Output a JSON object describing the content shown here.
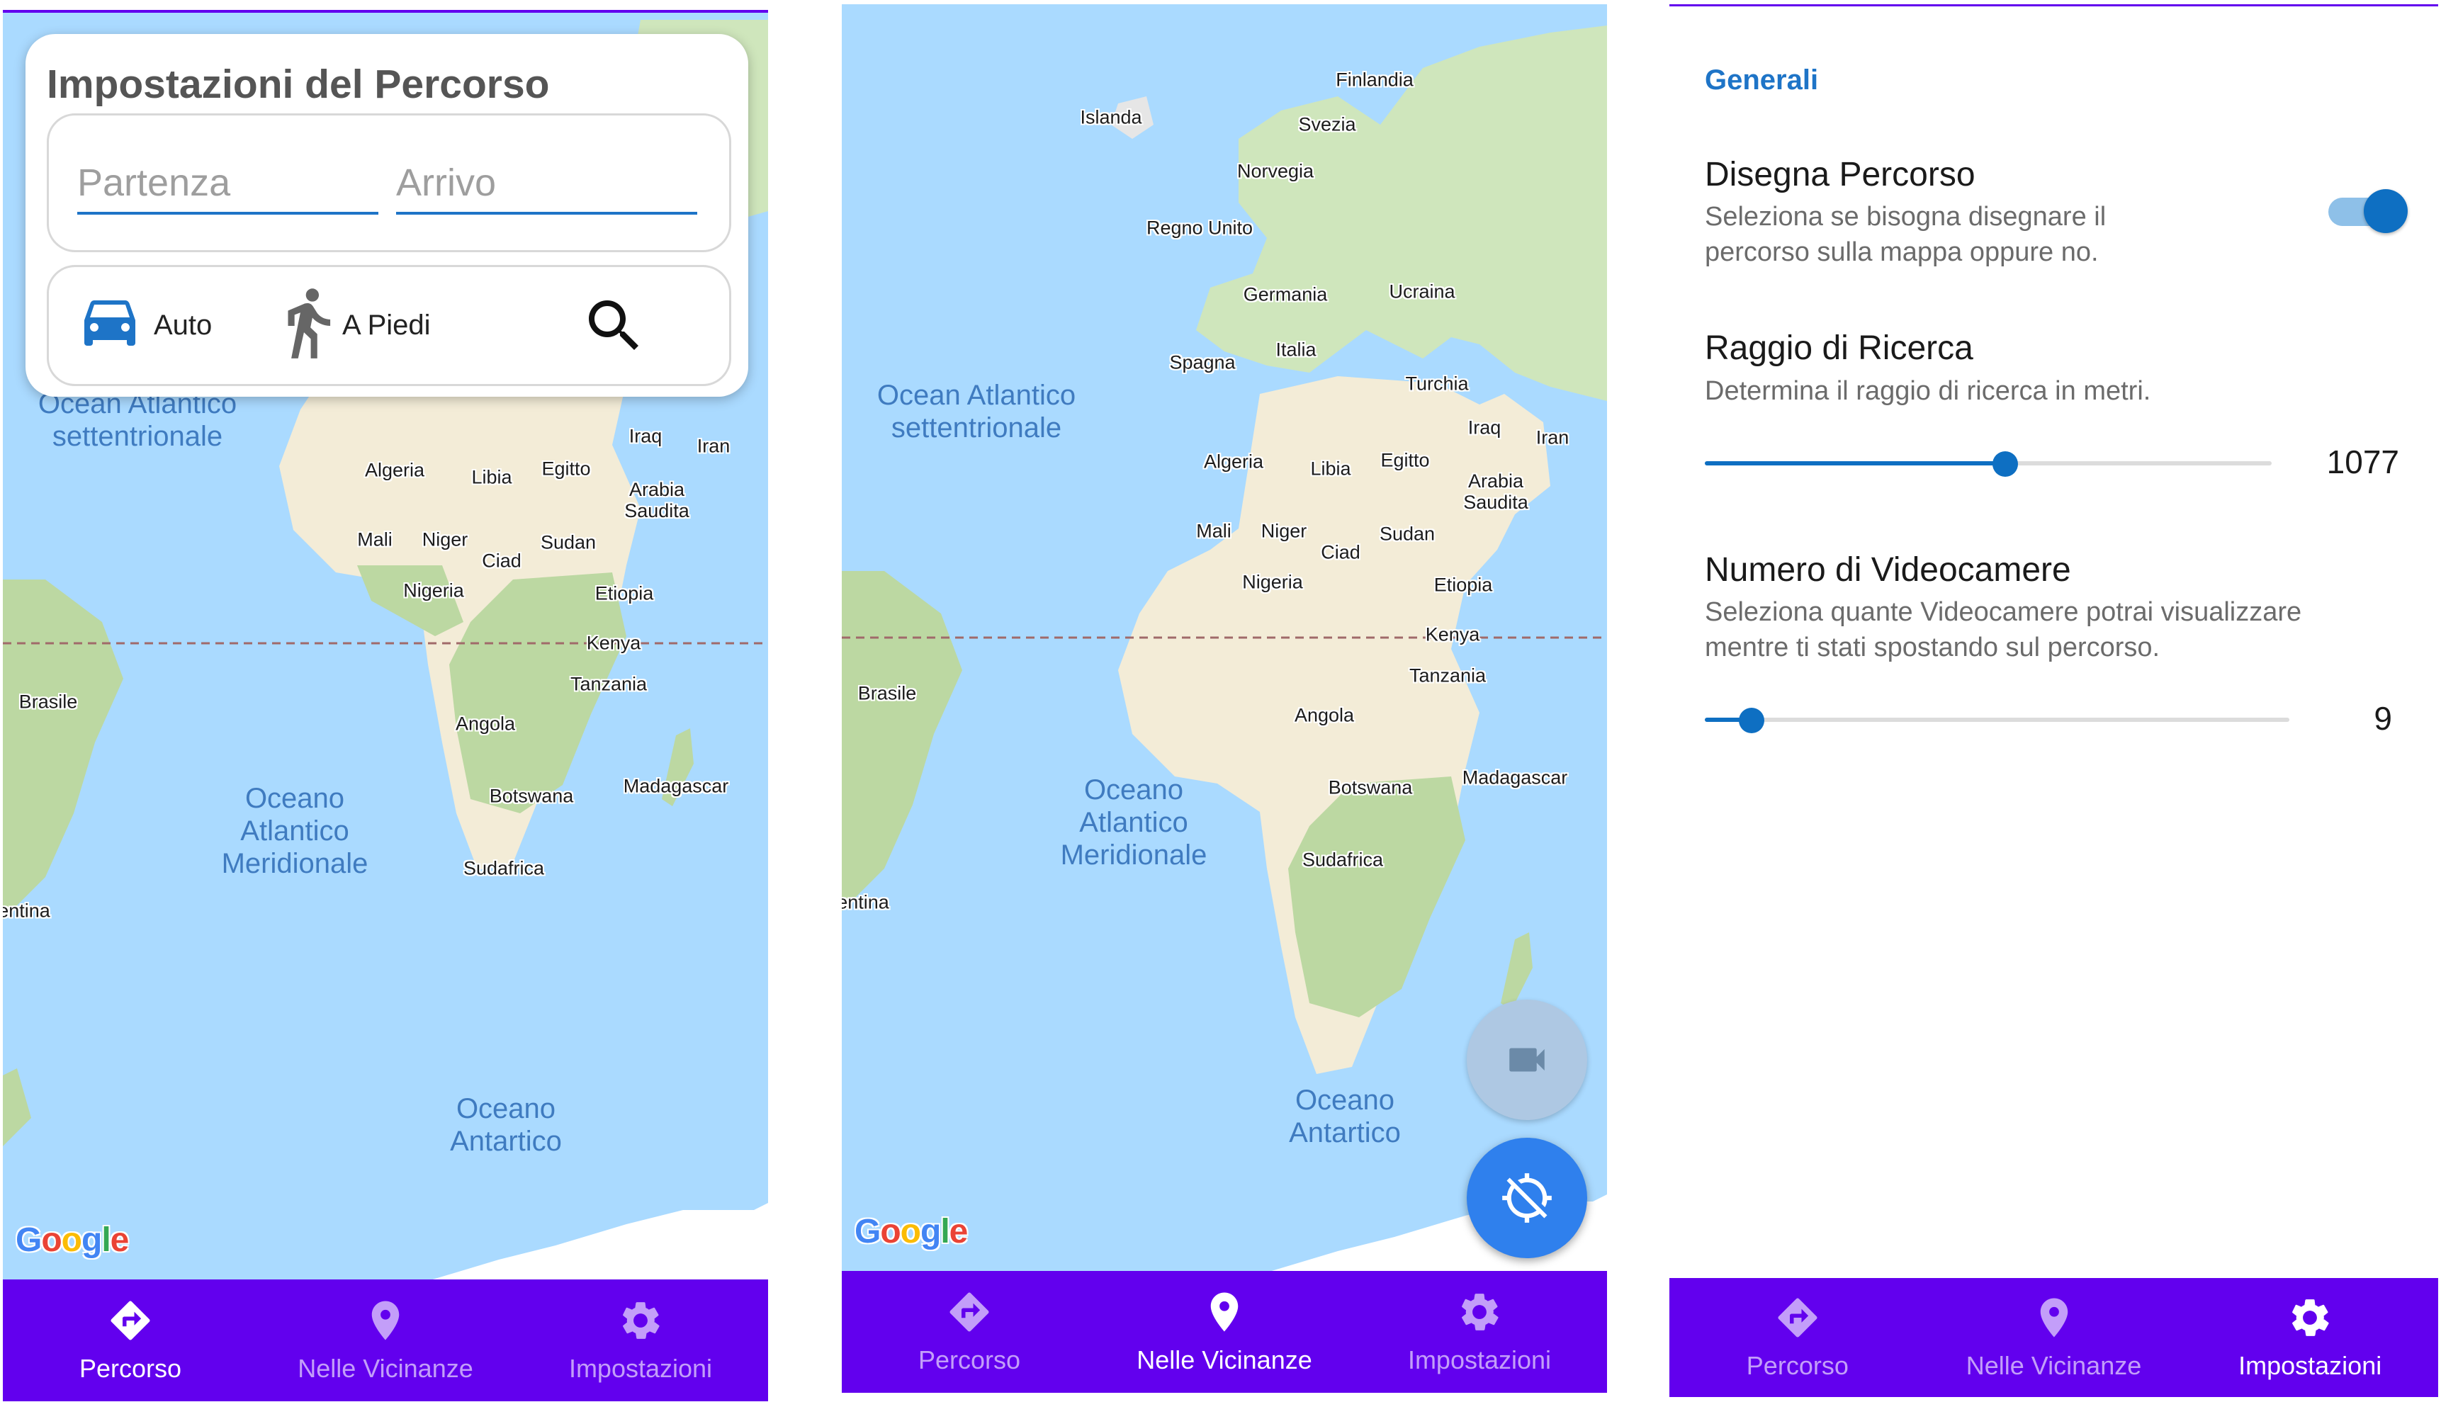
{
  "nav": {
    "items": [
      {
        "label": "Percorso",
        "icon": "directions-icon"
      },
      {
        "label": "Nelle Vicinanze",
        "icon": "place-icon"
      },
      {
        "label": "Impostazioni",
        "icon": "gear-icon"
      }
    ],
    "color": "#6200ee"
  },
  "map": {
    "labels": [
      "Finlandia",
      "Islanda",
      "Svezia",
      "Norvegia",
      "Regno Unito",
      "Germania",
      "Ucraina",
      "Spagna",
      "Italia",
      "Turchia",
      "Iraq",
      "Iran",
      "Algeria",
      "Libia",
      "Egitto",
      "Arabia Saudita",
      "Mali",
      "Niger",
      "Ciad",
      "Sudan",
      "Nigeria",
      "Etiopia",
      "Kenya",
      "Brasile",
      "Tanzania",
      "Angola",
      "Botswana",
      "Madagascar",
      "Sudafrica",
      "entina"
    ],
    "oceans": [
      "Ocean Atlantico\nsettentrionale",
      "Oceano\nAtlantico\nMeridionale",
      "Oceano\nAntartico"
    ],
    "google": "Google"
  },
  "route_card": {
    "title": "Impostazioni del Percorso",
    "start_placeholder": "Partenza",
    "end_placeholder": "Arrivo",
    "modes": [
      {
        "label": "Auto",
        "icon": "car-icon"
      },
      {
        "label": "A Piedi",
        "icon": "walk-icon"
      }
    ],
    "search_icon": "search-icon"
  },
  "nearby": {
    "camera_icon": "videocam-icon",
    "location_icon": "gps-off-icon"
  },
  "settings": {
    "category": "Generali",
    "draw_route": {
      "title": "Disegna Percorso",
      "summary": "Seleziona se bisogna disegnare il percorso sulla mappa oppure no.",
      "enabled": true
    },
    "radius": {
      "title": "Raggio di Ricerca",
      "summary": "Determina il raggio di ricerca in metri.",
      "value": "1077",
      "fraction": 0.53
    },
    "cameras": {
      "title": "Numero di Videocamere",
      "summary": "Seleziona quante Videocamere potrai visualizzare mentre ti stati spostando sul percorso.",
      "value": "9",
      "fraction": 0.08
    },
    "accent": "#0e6fc2"
  }
}
